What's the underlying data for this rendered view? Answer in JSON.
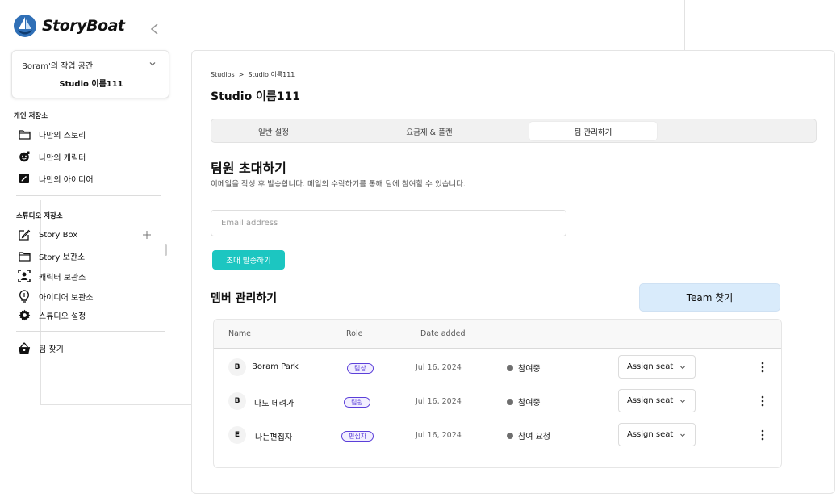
{
  "app": {
    "name": "StoryBoat"
  },
  "sidebar": {
    "workspace_owner": "Boram'의 작업 공간",
    "workspace_studio": "Studio 이름111",
    "personal_title": "개인 저장소",
    "personal_items": [
      {
        "label": "나만의 스토리",
        "icon": "folder-icon"
      },
      {
        "label": "나만의 캐릭터",
        "icon": "character-icon"
      },
      {
        "label": "나만의 아이디어",
        "icon": "idea-note-icon"
      }
    ],
    "studio_title": "스튜디오 저장소",
    "studio_items": [
      {
        "label": "Story Box",
        "icon": "edit-box-icon"
      },
      {
        "label": "Story 보관소",
        "icon": "folder-icon"
      },
      {
        "label": "캐릭터 보관소",
        "icon": "person-frame-icon"
      },
      {
        "label": "아이디어 보관소",
        "icon": "lightbulb-icon"
      },
      {
        "label": "스튜디오 설정",
        "icon": "gear-icon"
      }
    ],
    "team_item": {
      "label": "팀 찾기",
      "icon": "basket-icon"
    }
  },
  "breadcrumb": {
    "root": "Studios",
    "separator": ">",
    "current": "Studio 이름111"
  },
  "page_title": "Studio 이름111",
  "tabs": [
    {
      "label": "일반 설정",
      "active": false
    },
    {
      "label": "요금제 & 플랜",
      "active": false
    },
    {
      "label": "팀 관리하기",
      "active": true
    }
  ],
  "invite": {
    "title": "팀원 초대하기",
    "description": "이메일을 작성 후 발송합니다. 메일의 수락하기를 통해 팀에 참여할 수 있습니다.",
    "email_placeholder": "Email address",
    "email_value": "",
    "send_label": "초대 발송하기"
  },
  "members": {
    "title": "멤버 관리하기",
    "team_button": "Team 찾기",
    "columns": {
      "name": "Name",
      "role": "Role",
      "date": "Date added"
    },
    "rows": [
      {
        "initial": "B",
        "name": "Boram Park",
        "role": "팀장",
        "date": "Jul 16, 2024",
        "status": "참여중",
        "seat": "Assign seat"
      },
      {
        "initial": "B",
        "name": "나도 데려가",
        "role": "팀원",
        "date": "Jul 16, 2024",
        "status": "참여중",
        "seat": "Assign seat"
      },
      {
        "initial": "E",
        "name": "나는편집자",
        "role": "편집자",
        "date": "Jul 16, 2024",
        "status": "참여 요청",
        "seat": "Assign seat"
      }
    ]
  },
  "colors": {
    "accent": "#1cc6c1",
    "team_button_bg": "#d9ebfb",
    "role_badge": "#5b3fd9"
  }
}
